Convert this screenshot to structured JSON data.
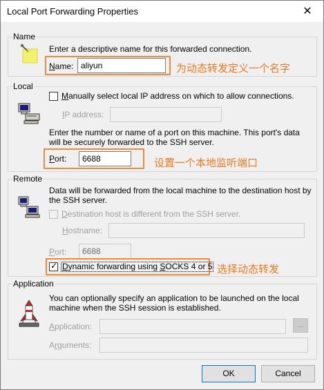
{
  "window": {
    "title": "Local Port Forwarding Properties",
    "close_glyph": "✕"
  },
  "name_group": {
    "label": "Name",
    "description": "Enter a descriptive name for this forwarded connection.",
    "field_label": "Name:",
    "field_value": "aliyun",
    "annotation": "为动态转发定义一个名字"
  },
  "local_group": {
    "label": "Local",
    "manual_checkbox_label": "Manually select local IP address on which to allow connections.",
    "manual_checked": false,
    "ip_label": "IP address:",
    "ip_value": "",
    "port_description_line1": "Enter the number or name of a port on this machine.  This port's data",
    "port_description_line2": "will be securely forwarded to the SSH server.",
    "port_label": "Port:",
    "port_value": "6688",
    "annotation": "设置一个本地监听端口"
  },
  "remote_group": {
    "label": "Remote",
    "description_line1": "Data will be forwarded from the local machine to the destination host by",
    "description_line2": "the SSH server.",
    "destination_checkbox_label": "Destination host is different from the SSH server.",
    "destination_checked": false,
    "hostname_label": "Hostname:",
    "hostname_value": "",
    "port_label": "Port:",
    "port_value": "6688",
    "dynamic_checkbox_label": "Dynamic forwarding using SOCKS 4 or 5",
    "dynamic_checked": true,
    "annotation": "选择动态转发"
  },
  "application_group": {
    "label": "Application",
    "description_line1": "You can optionally specify an application to be launched on the local",
    "description_line2": "machine when the SSH session is established.",
    "application_label": "Application:",
    "application_value": "",
    "browse_label": "...",
    "arguments_label": "Arguments:",
    "arguments_value": ""
  },
  "footer": {
    "ok_label": "OK",
    "cancel_label": "Cancel"
  },
  "colors": {
    "annotation": "#ee7a1e",
    "dialog_bg": "#f0f0f0",
    "default_button_border": "#0078d7"
  },
  "icons": {
    "name_icon": "sticky-note-pin-icon",
    "local_icon": "computer-icon",
    "remote_icon": "computers-network-icon",
    "application_icon": "rocket-launch-icon"
  }
}
